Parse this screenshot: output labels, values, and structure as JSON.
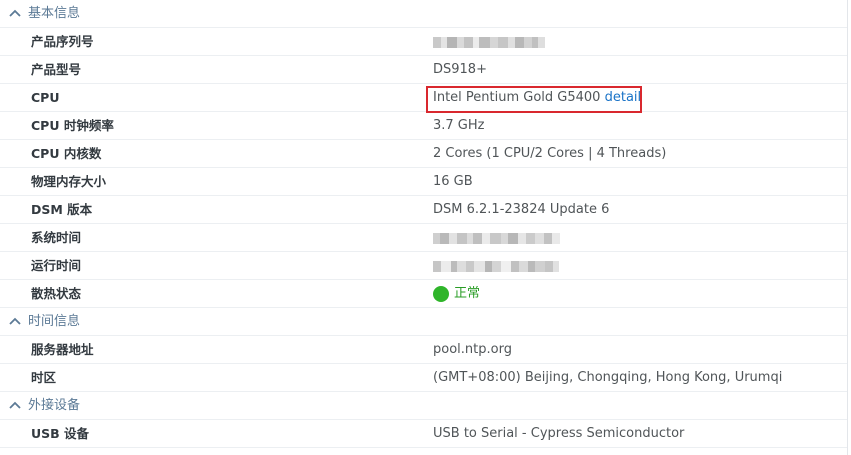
{
  "sections": {
    "basic": {
      "title": "基本信息",
      "rows": {
        "serial": {
          "label": "产品序列号",
          "value": ""
        },
        "model": {
          "label": "产品型号",
          "value": "DS918+"
        },
        "cpu": {
          "label": "CPU",
          "value": "Intel Pentium Gold G5400",
          "link": "detail"
        },
        "cpu_clock": {
          "label": "CPU 时钟频率",
          "value": "3.7 GHz"
        },
        "cpu_cores": {
          "label": "CPU 内核数",
          "value": "2 Cores (1 CPU/2 Cores | 4 Threads)"
        },
        "memory": {
          "label": "物理内存大小",
          "value": "16 GB"
        },
        "dsm": {
          "label": "DSM 版本",
          "value": "DSM 6.2.1-23824 Update 6"
        },
        "system_time": {
          "label": "系统时间",
          "value": ""
        },
        "uptime": {
          "label": "运行时间",
          "value": ""
        },
        "thermal": {
          "label": "散热状态",
          "value": "正常"
        }
      }
    },
    "time": {
      "title": "时间信息",
      "rows": {
        "server": {
          "label": "服务器地址",
          "value": "pool.ntp.org"
        },
        "timezone": {
          "label": "时区",
          "value": "(GMT+08:00) Beijing, Chongqing, Hong Kong, Urumqi"
        }
      }
    },
    "external": {
      "title": "外接设备",
      "rows": {
        "usb": {
          "label": "USB 设备",
          "value": "USB to Serial - Cypress Semiconductor"
        }
      }
    }
  },
  "colors": {
    "section_title": "#5c7a96",
    "link": "#1a73c7",
    "status_ok": "#2fb52a",
    "highlight_border": "#d9282e"
  },
  "icons": {
    "section_toggle": "chevron-up-icon",
    "status": "status-ok-dot-icon"
  }
}
